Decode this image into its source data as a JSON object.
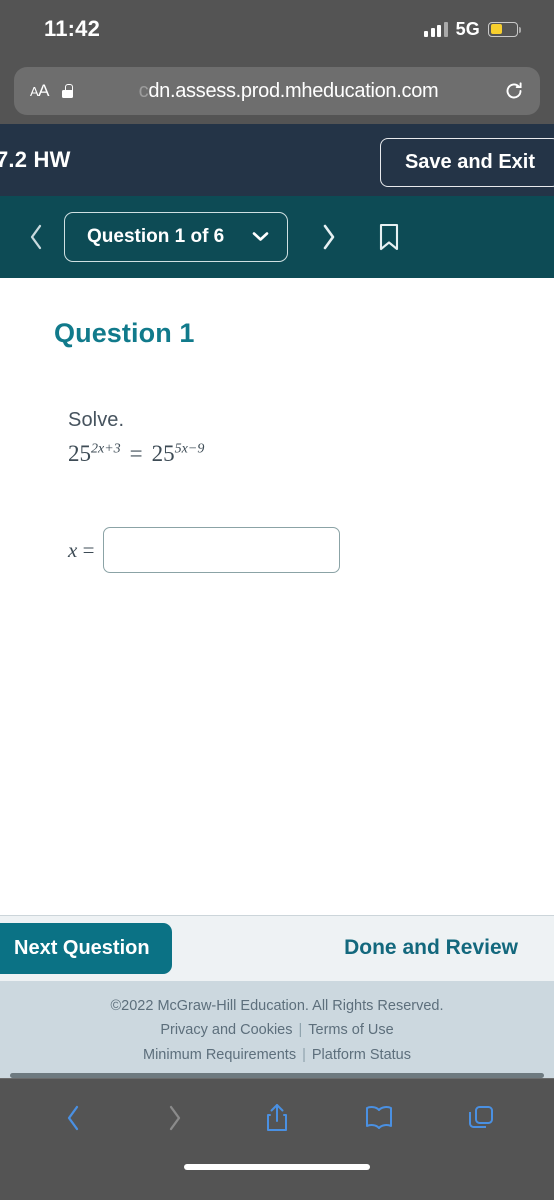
{
  "status_bar": {
    "time": "11:42",
    "network": "5G",
    "signal_icon": "cellular-signal-icon",
    "battery_icon": "battery-low-power-icon",
    "battery_color": "#f7cf2e"
  },
  "browser": {
    "text_size_label": "AA",
    "lock_icon": "lock-icon",
    "url_hidden_prefix": "c",
    "url": "dn.assess.prod.mheducation.com",
    "reload_icon": "reload-icon"
  },
  "assignment_header": {
    "title": "7.2 HW",
    "save_exit_label": "Save and Exit",
    "background": "#243447"
  },
  "question_nav": {
    "prev_icon": "chevron-left-icon",
    "selector_label": "Question 1 of 6",
    "selector_caret_icon": "chevron-down-icon",
    "next_icon": "chevron-right-icon",
    "bookmark_icon": "bookmark-icon",
    "background": "#0d4b55"
  },
  "question": {
    "heading": "Question 1",
    "prompt": "Solve.",
    "equation": {
      "left_base": "25",
      "left_exponent": "2x+3",
      "operator": "=",
      "right_base": "25",
      "right_exponent": "5x−9",
      "plain": "25^(2x+3) = 25^(5x−9)"
    },
    "answer_label_var": "x",
    "answer_label_eq": "=",
    "answer_value": "",
    "answer_placeholder": "",
    "heading_color": "#117a8b"
  },
  "action_bar": {
    "next_question_label": "Next Question",
    "done_review_label": "Done and Review",
    "primary_color": "#0b7285"
  },
  "footer": {
    "copyright": "©2022 McGraw-Hill Education. All Rights Reserved.",
    "links_row1": [
      "Privacy and Cookies",
      "Terms of Use"
    ],
    "links_row2": [
      "Minimum Requirements",
      "Platform Status"
    ],
    "separator": "|"
  },
  "safari_toolbar": {
    "back_icon": "chevron-left-icon",
    "forward_icon": "chevron-right-icon",
    "share_icon": "share-icon",
    "bookmarks_icon": "book-icon",
    "tabs_icon": "tabs-icon",
    "active_color": "#4a90e2",
    "disabled_color": "#8b8b8b"
  }
}
